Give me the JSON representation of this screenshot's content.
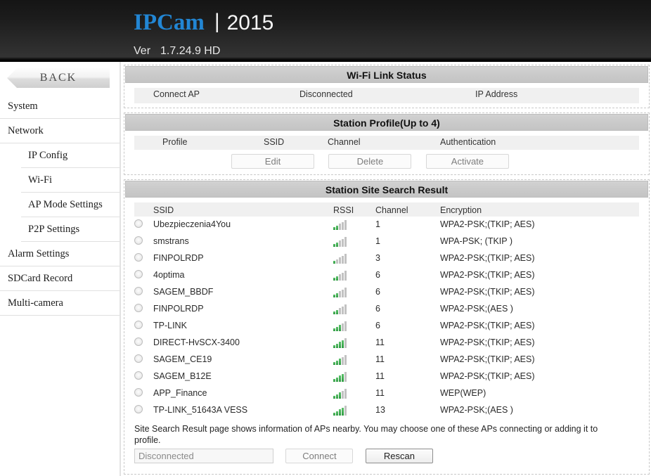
{
  "header": {
    "brand": "IPCam",
    "separator": "|",
    "year": "2015",
    "ver_label": "Ver",
    "ver_value": "1.7.24.9 HD",
    "brand_color": "#2286d4"
  },
  "sidebar": {
    "back_label": "BACK",
    "items": [
      {
        "label": "System",
        "sub": false
      },
      {
        "label": "Network",
        "sub": false
      },
      {
        "label": "IP Config",
        "sub": true
      },
      {
        "label": "Wi-Fi",
        "sub": true
      },
      {
        "label": "AP Mode Settings",
        "sub": true
      },
      {
        "label": "P2P Settings",
        "sub": true
      },
      {
        "label": "Alarm Settings",
        "sub": false
      },
      {
        "label": "SDCard Record",
        "sub": false
      },
      {
        "label": "Multi-camera",
        "sub": false
      }
    ]
  },
  "link_status": {
    "title": "Wi-Fi Link Status",
    "connect_ap_label": "Connect AP",
    "state": "Disconnected",
    "ip_address_label": "IP Address"
  },
  "station_profile": {
    "title": "Station Profile(Up to 4)",
    "columns": [
      "Profile",
      "SSID",
      "Channel",
      "Authentication"
    ],
    "buttons": [
      {
        "label": "Edit",
        "enabled": false
      },
      {
        "label": "Delete",
        "enabled": false
      },
      {
        "label": "Activate",
        "enabled": false
      }
    ]
  },
  "site_search": {
    "title": "Station Site Search Result",
    "columns": [
      "SSID",
      "RSSI",
      "Channel",
      "Encryption"
    ],
    "rows": [
      {
        "ssid": "Ubezpieczenia4You",
        "rssi": 2,
        "channel": "1",
        "encryption": "WPA2-PSK;(TKIP; AES)"
      },
      {
        "ssid": "smstrans",
        "rssi": 2,
        "channel": "1",
        "encryption": "WPA-PSK; (TKIP )"
      },
      {
        "ssid": "FINPOLRDP",
        "rssi": 1,
        "channel": "3",
        "encryption": "WPA2-PSK;(TKIP; AES)"
      },
      {
        "ssid": "4optima",
        "rssi": 2,
        "channel": "6",
        "encryption": "WPA2-PSK;(TKIP; AES)"
      },
      {
        "ssid": "SAGEM_BBDF",
        "rssi": 2,
        "channel": "6",
        "encryption": "WPA2-PSK;(TKIP; AES)"
      },
      {
        "ssid": "FINPOLRDP",
        "rssi": 2,
        "channel": "6",
        "encryption": "WPA2-PSK;(AES )"
      },
      {
        "ssid": "TP-LINK",
        "rssi": 3,
        "channel": "6",
        "encryption": "WPA2-PSK;(TKIP; AES)"
      },
      {
        "ssid": "DIRECT-HvSCX-3400",
        "rssi": 4,
        "channel": "11",
        "encryption": "WPA2-PSK;(TKIP; AES)"
      },
      {
        "ssid": "SAGEM_CE19",
        "rssi": 3,
        "channel": "11",
        "encryption": "WPA2-PSK;(TKIP; AES)"
      },
      {
        "ssid": "SAGEM_B12E",
        "rssi": 4,
        "channel": "11",
        "encryption": "WPA2-PSK;(TKIP; AES)"
      },
      {
        "ssid": "APP_Finance",
        "rssi": 3,
        "channel": "11",
        "encryption": "WEP(WEP)"
      },
      {
        "ssid": "TP-LINK_51643A VESS",
        "rssi": 4,
        "channel": "13",
        "encryption": "WPA2-PSK;(AES )"
      }
    ],
    "note": "Site Search Result page shows information of APs nearby. You may choose one of these APs connecting or adding it to profile.",
    "status_field_value": "Disconnected",
    "connect_label": "Connect",
    "rescan_label": "Rescan"
  }
}
